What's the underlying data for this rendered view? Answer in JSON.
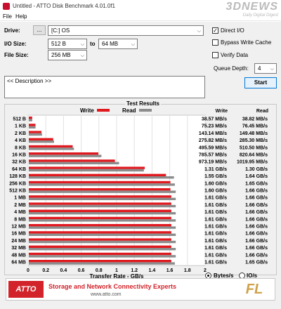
{
  "window": {
    "title": "Untitled - ATTO Disk Benchmark 4.01.0f1"
  },
  "menu": [
    "File",
    "Help"
  ],
  "watermark": {
    "logo_text": "3DNEWS",
    "tagline": "Daily Digital Digest"
  },
  "controls": {
    "drive_label": "Drive:",
    "browse_label": "...",
    "drive_value": "[C:] OS",
    "io_size_label": "I/O Size:",
    "io_from": "512 B",
    "io_to_label": "to",
    "io_to": "64 MB",
    "file_size_label": "File Size:",
    "file_size": "256 MB",
    "direct_io_label": "Direct I/O",
    "direct_io_checked": true,
    "bypass_cache_label": "Bypass Write Cache",
    "bypass_cache_checked": false,
    "verify_data_label": "Verify Data",
    "verify_data_checked": false,
    "queue_depth_label": "Queue Depth:",
    "queue_depth": "4",
    "description": "<< Description >>",
    "start_label": "Start"
  },
  "results": {
    "title": "Test Results",
    "write_label": "Write",
    "read_label": "Read",
    "write_col_header": "Write",
    "read_col_header": "Read",
    "xlabel": "Transfer Rate - GB/s",
    "unit_bytes_label": "Bytes/s",
    "unit_io_label": "IO/s",
    "unit_selected": "bytes",
    "write_color": "#e0191f",
    "read_color": "#8c8c8c"
  },
  "chart_data": {
    "type": "bar",
    "orientation": "horizontal",
    "title": "Test Results",
    "xlabel": "Transfer Rate - GB/s",
    "xlim": [
      0,
      2
    ],
    "xticks": [
      "0",
      "0.2",
      "0.4",
      "0.6",
      "0.8",
      "1",
      "1.2",
      "1.4",
      "1.6",
      "1.8",
      "2"
    ],
    "grid": true,
    "legend": "top",
    "categories": [
      "512 B",
      "1 KB",
      "2 KB",
      "4 KB",
      "8 KB",
      "16 KB",
      "32 KB",
      "64 KB",
      "128 KB",
      "256 KB",
      "512 KB",
      "1 MB",
      "2 MB",
      "4 MB",
      "8 MB",
      "12 MB",
      "16 MB",
      "24 MB",
      "32 MB",
      "48 MB",
      "64 MB"
    ],
    "series": [
      {
        "name": "Write",
        "values": [
          0.0386,
          0.0752,
          0.1431,
          0.2758,
          0.496,
          0.7856,
          0.9732,
          1.31,
          1.55,
          1.6,
          1.6,
          1.61,
          1.61,
          1.61,
          1.61,
          1.61,
          1.61,
          1.61,
          1.61,
          1.61,
          1.61
        ],
        "labels": [
          "38.57 MB/s",
          "75.23 MB/s",
          "143.14 MB/s",
          "275.82 MB/s",
          "495.59 MB/s",
          "785.57 MB/s",
          "973.19 MB/s",
          "1.31 GB/s",
          "1.55 GB/s",
          "1.60 GB/s",
          "1.60 GB/s",
          "1.61 GB/s",
          "1.61 GB/s",
          "1.61 GB/s",
          "1.61 GB/s",
          "1.61 GB/s",
          "1.61 GB/s",
          "1.61 GB/s",
          "1.61 GB/s",
          "1.61 GB/s",
          "1.61 GB/s"
        ]
      },
      {
        "name": "Read",
        "values": [
          0.0388,
          0.0765,
          0.1495,
          0.2853,
          0.5105,
          0.8206,
          1.02,
          1.3,
          1.64,
          1.65,
          1.66,
          1.66,
          1.66,
          1.66,
          1.66,
          1.66,
          1.66,
          1.66,
          1.66,
          1.66,
          1.65
        ],
        "labels": [
          "38.82 MB/s",
          "76.45 MB/s",
          "149.48 MB/s",
          "285.30 MB/s",
          "510.50 MB/s",
          "820.64 MB/s",
          "1019.95 MB/s",
          "1.30 GB/s",
          "1.64 GB/s",
          "1.65 GB/s",
          "1.66 GB/s",
          "1.66 GB/s",
          "1.66 GB/s",
          "1.66 GB/s",
          "1.66 GB/s",
          "1.66 GB/s",
          "1.66 GB/s",
          "1.66 GB/s",
          "1.66 GB/s",
          "1.66 GB/s",
          "1.65 GB/s"
        ]
      }
    ]
  },
  "banner": {
    "logo": "ATTO",
    "headline": "Storage and Network Connectivity Experts",
    "url": "www.atto.com",
    "corner_logo": "FL"
  }
}
